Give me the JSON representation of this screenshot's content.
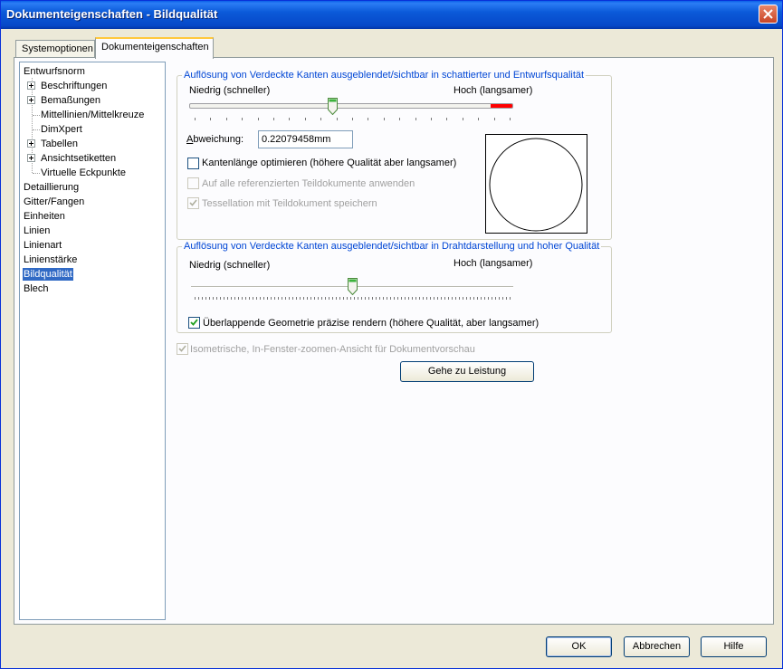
{
  "window": {
    "title": "Dokumenteigenschaften - Bildqualität"
  },
  "tabs": [
    {
      "label": "Systemoptionen"
    },
    {
      "label": "Dokumenteigenschaften"
    }
  ],
  "tree": [
    {
      "label": "Entwurfsnorm"
    },
    {
      "label": "Beschriftungen"
    },
    {
      "label": "Bemaßungen"
    },
    {
      "label": "Mittellinien/Mittelkreuze"
    },
    {
      "label": "DimXpert"
    },
    {
      "label": "Tabellen"
    },
    {
      "label": "Ansichtsetiketten"
    },
    {
      "label": "Virtuelle Eckpunkte"
    },
    {
      "label": "Detaillierung"
    },
    {
      "label": "Gitter/Fangen"
    },
    {
      "label": "Einheiten"
    },
    {
      "label": "Linien"
    },
    {
      "label": "Linienart"
    },
    {
      "label": "Linienstärke"
    },
    {
      "label": "Bildqualität"
    },
    {
      "label": "Blech"
    }
  ],
  "group1": {
    "title": "Auflösung von Verdeckte Kanten ausgeblendet/sichtbar in schattierter und Entwurfsqualität",
    "low_label": "Niedrig (schneller)",
    "high_label": "Hoch (langsamer)",
    "slider_value": 0.44,
    "deviation_label": "Abweichung:",
    "deviation_value": "0.22079458mm",
    "opt_edge_length": "Kantenlänge optimieren (höhere Qualität aber langsamer)",
    "opt_apply_all": "Auf alle referenzierten Teildokumente anwenden",
    "opt_save_tess": "Tessellation mit Teildokument speichern"
  },
  "group2": {
    "title": "Auflösung von Verdeckte Kanten ausgeblendet/sichtbar in Drahtdarstellung und hoher Qualität",
    "low_label": "Niedrig (schneller)",
    "high_label": "Hoch (langsamer)",
    "slider_value": 0.5,
    "opt_precise_render": "Überlappende Geometrie präzise rendern (höhere Qualität, aber langsamer)"
  },
  "isometric_option": "Isometrische, In-Fenster-zoomen-Ansicht für Dokumentvorschau",
  "performance_button": "Gehe zu Leistung",
  "buttons": {
    "ok": "OK",
    "cancel": "Abbrechen",
    "help": "Hilfe"
  },
  "colors": {
    "accent": "#316ac5",
    "slider_high": "#ff0000",
    "group_title": "#0046d5"
  }
}
